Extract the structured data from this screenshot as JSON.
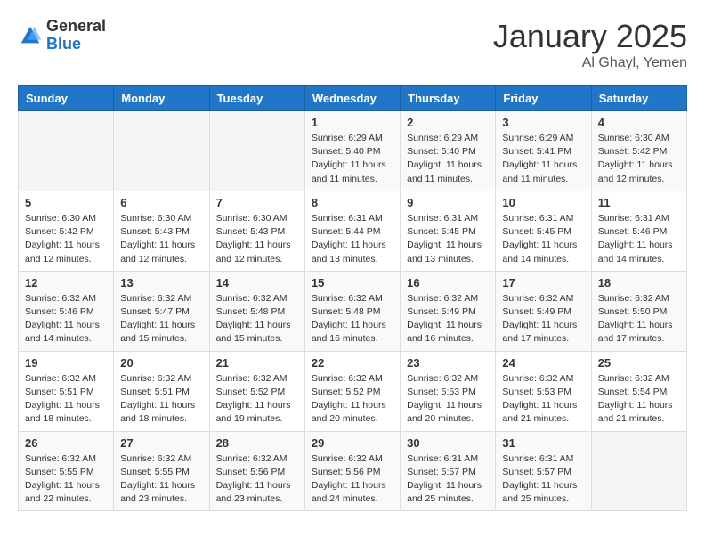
{
  "logo": {
    "general": "General",
    "blue": "Blue"
  },
  "header": {
    "month": "January 2025",
    "location": "Al Ghayl, Yemen"
  },
  "weekdays": [
    "Sunday",
    "Monday",
    "Tuesday",
    "Wednesday",
    "Thursday",
    "Friday",
    "Saturday"
  ],
  "weeks": [
    [
      {
        "day": "",
        "info": ""
      },
      {
        "day": "",
        "info": ""
      },
      {
        "day": "",
        "info": ""
      },
      {
        "day": "1",
        "info": "Sunrise: 6:29 AM\nSunset: 5:40 PM\nDaylight: 11 hours and 11 minutes."
      },
      {
        "day": "2",
        "info": "Sunrise: 6:29 AM\nSunset: 5:40 PM\nDaylight: 11 hours and 11 minutes."
      },
      {
        "day": "3",
        "info": "Sunrise: 6:29 AM\nSunset: 5:41 PM\nDaylight: 11 hours and 11 minutes."
      },
      {
        "day": "4",
        "info": "Sunrise: 6:30 AM\nSunset: 5:42 PM\nDaylight: 11 hours and 12 minutes."
      }
    ],
    [
      {
        "day": "5",
        "info": "Sunrise: 6:30 AM\nSunset: 5:42 PM\nDaylight: 11 hours and 12 minutes."
      },
      {
        "day": "6",
        "info": "Sunrise: 6:30 AM\nSunset: 5:43 PM\nDaylight: 11 hours and 12 minutes."
      },
      {
        "day": "7",
        "info": "Sunrise: 6:30 AM\nSunset: 5:43 PM\nDaylight: 11 hours and 12 minutes."
      },
      {
        "day": "8",
        "info": "Sunrise: 6:31 AM\nSunset: 5:44 PM\nDaylight: 11 hours and 13 minutes."
      },
      {
        "day": "9",
        "info": "Sunrise: 6:31 AM\nSunset: 5:45 PM\nDaylight: 11 hours and 13 minutes."
      },
      {
        "day": "10",
        "info": "Sunrise: 6:31 AM\nSunset: 5:45 PM\nDaylight: 11 hours and 14 minutes."
      },
      {
        "day": "11",
        "info": "Sunrise: 6:31 AM\nSunset: 5:46 PM\nDaylight: 11 hours and 14 minutes."
      }
    ],
    [
      {
        "day": "12",
        "info": "Sunrise: 6:32 AM\nSunset: 5:46 PM\nDaylight: 11 hours and 14 minutes."
      },
      {
        "day": "13",
        "info": "Sunrise: 6:32 AM\nSunset: 5:47 PM\nDaylight: 11 hours and 15 minutes."
      },
      {
        "day": "14",
        "info": "Sunrise: 6:32 AM\nSunset: 5:48 PM\nDaylight: 11 hours and 15 minutes."
      },
      {
        "day": "15",
        "info": "Sunrise: 6:32 AM\nSunset: 5:48 PM\nDaylight: 11 hours and 16 minutes."
      },
      {
        "day": "16",
        "info": "Sunrise: 6:32 AM\nSunset: 5:49 PM\nDaylight: 11 hours and 16 minutes."
      },
      {
        "day": "17",
        "info": "Sunrise: 6:32 AM\nSunset: 5:49 PM\nDaylight: 11 hours and 17 minutes."
      },
      {
        "day": "18",
        "info": "Sunrise: 6:32 AM\nSunset: 5:50 PM\nDaylight: 11 hours and 17 minutes."
      }
    ],
    [
      {
        "day": "19",
        "info": "Sunrise: 6:32 AM\nSunset: 5:51 PM\nDaylight: 11 hours and 18 minutes."
      },
      {
        "day": "20",
        "info": "Sunrise: 6:32 AM\nSunset: 5:51 PM\nDaylight: 11 hours and 18 minutes."
      },
      {
        "day": "21",
        "info": "Sunrise: 6:32 AM\nSunset: 5:52 PM\nDaylight: 11 hours and 19 minutes."
      },
      {
        "day": "22",
        "info": "Sunrise: 6:32 AM\nSunset: 5:52 PM\nDaylight: 11 hours and 20 minutes."
      },
      {
        "day": "23",
        "info": "Sunrise: 6:32 AM\nSunset: 5:53 PM\nDaylight: 11 hours and 20 minutes."
      },
      {
        "day": "24",
        "info": "Sunrise: 6:32 AM\nSunset: 5:53 PM\nDaylight: 11 hours and 21 minutes."
      },
      {
        "day": "25",
        "info": "Sunrise: 6:32 AM\nSunset: 5:54 PM\nDaylight: 11 hours and 21 minutes."
      }
    ],
    [
      {
        "day": "26",
        "info": "Sunrise: 6:32 AM\nSunset: 5:55 PM\nDaylight: 11 hours and 22 minutes."
      },
      {
        "day": "27",
        "info": "Sunrise: 6:32 AM\nSunset: 5:55 PM\nDaylight: 11 hours and 23 minutes."
      },
      {
        "day": "28",
        "info": "Sunrise: 6:32 AM\nSunset: 5:56 PM\nDaylight: 11 hours and 23 minutes."
      },
      {
        "day": "29",
        "info": "Sunrise: 6:32 AM\nSunset: 5:56 PM\nDaylight: 11 hours and 24 minutes."
      },
      {
        "day": "30",
        "info": "Sunrise: 6:31 AM\nSunset: 5:57 PM\nDaylight: 11 hours and 25 minutes."
      },
      {
        "day": "31",
        "info": "Sunrise: 6:31 AM\nSunset: 5:57 PM\nDaylight: 11 hours and 25 minutes."
      },
      {
        "day": "",
        "info": ""
      }
    ]
  ]
}
